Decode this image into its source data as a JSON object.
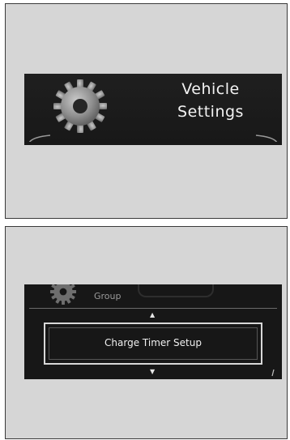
{
  "vehicle_settings_screen": {
    "title_line1": "Vehicle",
    "title_line2": "Settings",
    "icon": "gear-icon"
  },
  "charge_timer_screen": {
    "group_label": "Group",
    "selected_option": "Charge Timer Setup",
    "icons": {
      "group": "gear-icon",
      "up": "arrow-up-icon",
      "down": "arrow-down-icon"
    },
    "arrow_up_glyph": "▲",
    "arrow_down_glyph": "▼"
  },
  "colors": {
    "panel_background": "#d6d6d6",
    "screen_background": "#1c1c1c",
    "text": "#f2f2f2"
  }
}
